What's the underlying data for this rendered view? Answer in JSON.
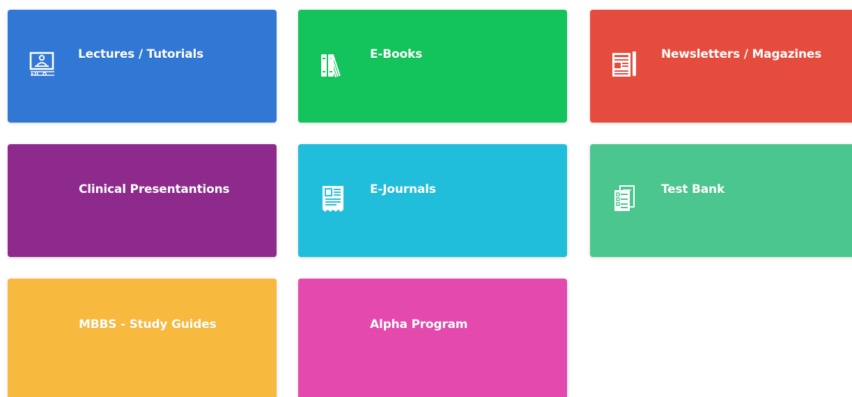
{
  "tiles": [
    {
      "label": "Lectures / Tutorials",
      "color": "#3177d4",
      "icon": "video-lecture-icon"
    },
    {
      "label": "E-Books",
      "color": "#13c35b",
      "icon": "books-icon"
    },
    {
      "label": "Newsletters / Magazines",
      "color": "#e64c3d",
      "icon": "newspaper-icon"
    },
    {
      "label": "Clinical Presentantions",
      "color": "#8e2a8c",
      "icon": null
    },
    {
      "label": "E-Journals",
      "color": "#21bedb",
      "icon": "journal-icon"
    },
    {
      "label": "Test Bank",
      "color": "#4bc68f",
      "icon": "checklist-icon"
    },
    {
      "label": "MBBS - Study Guides",
      "color": "#f7b93e",
      "icon": null
    },
    {
      "label": "Alpha Program",
      "color": "#e44aad",
      "icon": null
    }
  ]
}
